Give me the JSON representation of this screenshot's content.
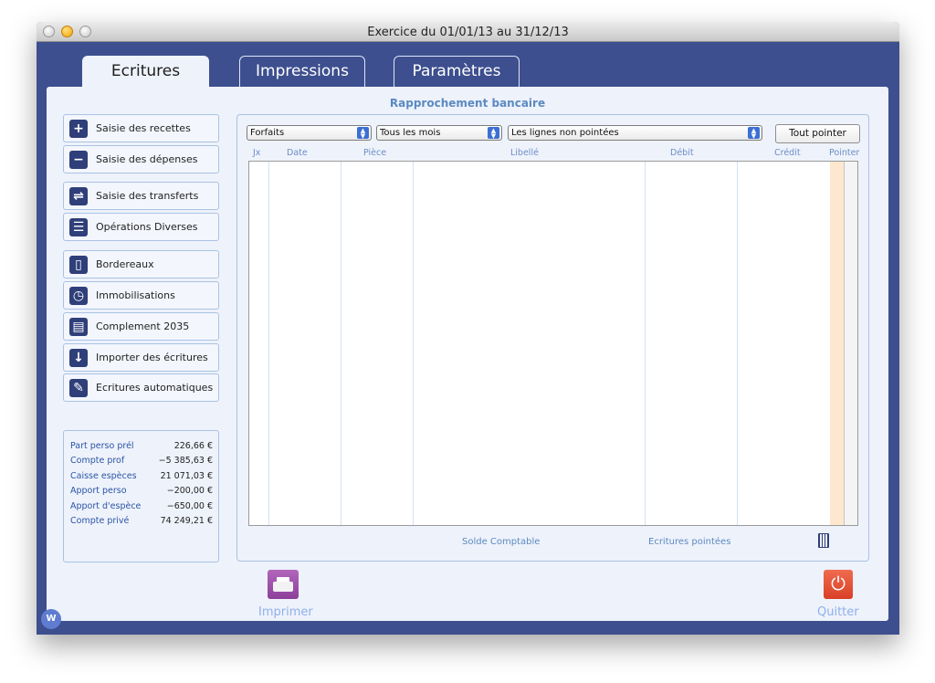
{
  "window": {
    "title": "Exercice du 01/01/13 au 31/12/13"
  },
  "tabs": [
    {
      "label": "Ecritures"
    },
    {
      "label": "Impressions"
    },
    {
      "label": "Paramètres"
    }
  ],
  "section_title": "Rapprochement bancaire",
  "sidebar": {
    "items": [
      {
        "label": "Saisie des recettes",
        "icon": "plus-icon"
      },
      {
        "label": "Saisie des dépenses",
        "icon": "minus-icon"
      },
      {
        "label": "Saisie des transferts",
        "icon": "transfer-icon"
      },
      {
        "label": "Opérations Diverses",
        "icon": "ledger-icon"
      },
      {
        "label": "Bordereaux",
        "icon": "page-icon"
      },
      {
        "label": "Immobilisations",
        "icon": "stopwatch-icon"
      },
      {
        "label": "Complement 2035",
        "icon": "document-icon"
      },
      {
        "label": "Importer des écritures",
        "icon": "import-icon"
      },
      {
        "label": "Ecritures automatiques",
        "icon": "pen-icon"
      }
    ]
  },
  "summary": [
    {
      "label": "Part perso prél",
      "value": "226,66 €"
    },
    {
      "label": "Compte prof",
      "value": "−5 385,63 €"
    },
    {
      "label": "Caisse espèces",
      "value": "21 071,03 €"
    },
    {
      "label": "Apport perso",
      "value": "−200,00 €"
    },
    {
      "label": "Apport d'espèce",
      "value": "−650,00 €"
    },
    {
      "label": "Compte privé",
      "value": "74 249,21 €"
    }
  ],
  "filters": {
    "account": "Forfaits",
    "period": "Tous les mois",
    "lines": "Les lignes non pointées",
    "point_all": "Tout pointer"
  },
  "columns": [
    "Jx",
    "Date",
    "Pièce",
    "Libellé",
    "Débit",
    "Crédit",
    "Pointer"
  ],
  "footer": {
    "solde": "Solde Comptable",
    "pointees": "Ecritures pointées"
  },
  "actions": {
    "print": "Imprimer",
    "quit": "Quitter"
  },
  "badge": "W",
  "colors": {
    "frame": "#3d4f8e",
    "panel": "#eef2fb",
    "accent": "#5b8ac0"
  }
}
